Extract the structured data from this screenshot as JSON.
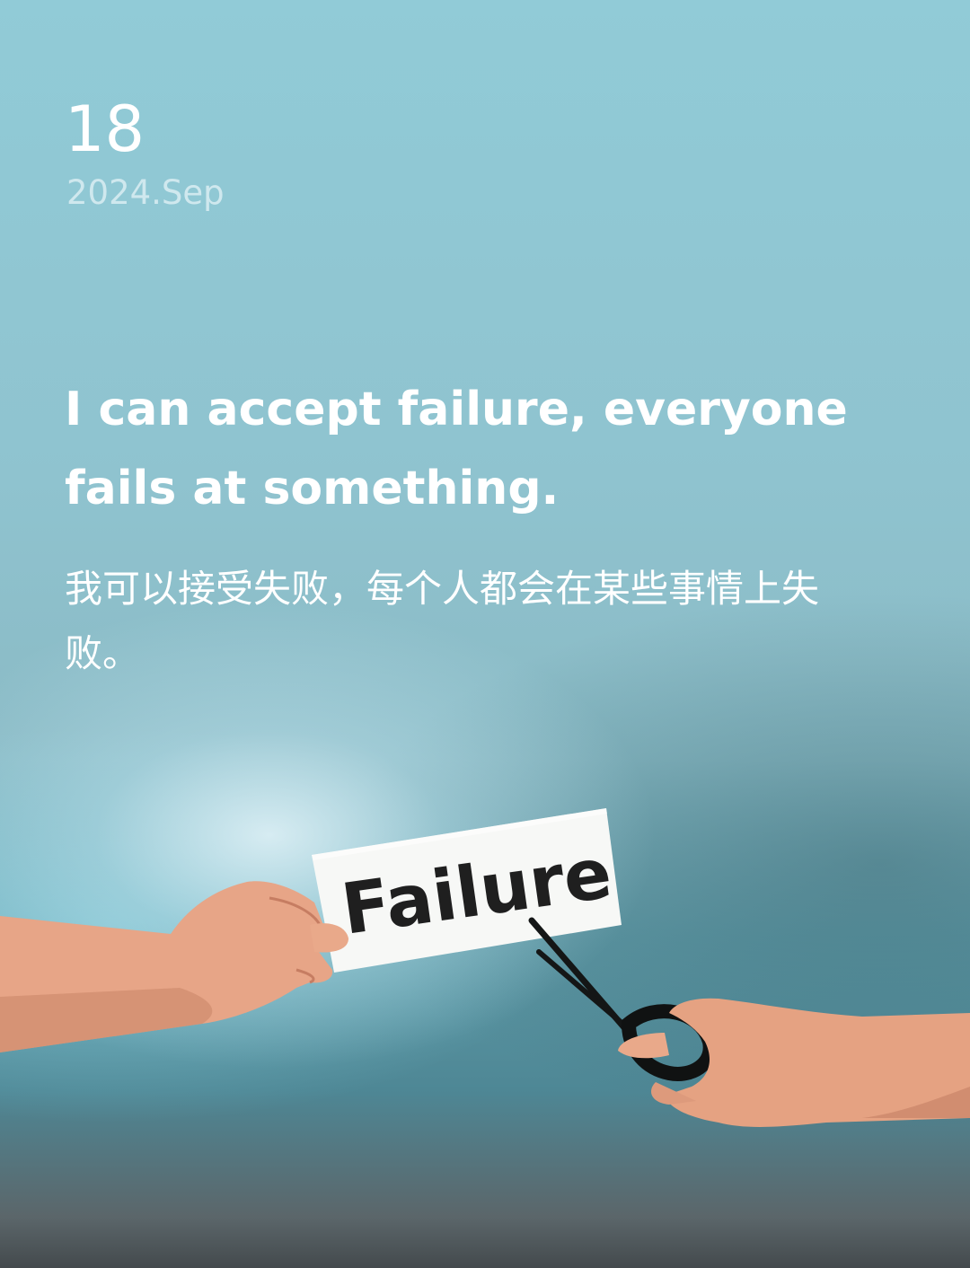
{
  "date": {
    "day": "18",
    "month_year": "2024.Sep"
  },
  "quote": {
    "english": "I can accept failure, everyone fails at something.",
    "chinese": "我可以接受失败，每个人都会在某些事情上失败。"
  },
  "photo": {
    "card_text": "Failure",
    "colors": {
      "skin": "#e9a98a",
      "skin_shadow": "#c98468",
      "paper": "#f7f8f6",
      "ink": "#1f1f1f",
      "scissors": "#121414"
    }
  }
}
